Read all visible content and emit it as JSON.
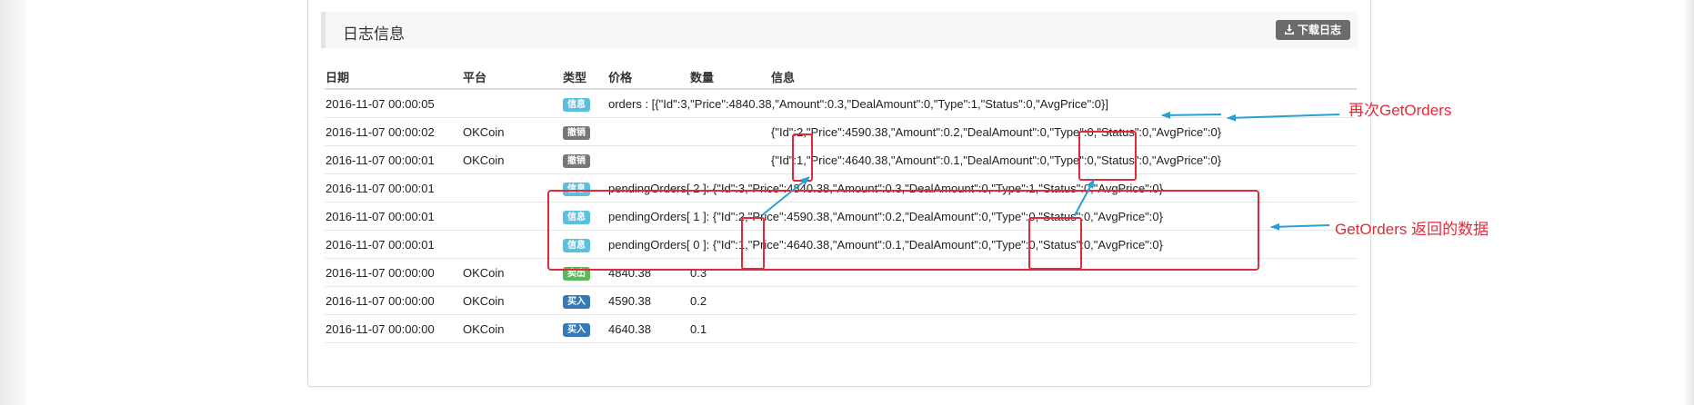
{
  "panel": {
    "title": "日志信息",
    "download_label": "下载日志"
  },
  "table": {
    "headers": [
      "日期",
      "平台",
      "类型",
      "价格",
      "数量",
      "信息"
    ],
    "rows": [
      {
        "date": "2016-11-07 00:00:05",
        "platform": "",
        "type": "信息",
        "price": "orders : [{\"Id\":3,\"Price\":4840.38,\"Amount\":0.3,\"DealAmount\":0,\"Type\":1,\"Status\":0,\"AvgPrice\":0}]",
        "amount": "",
        "info": ""
      },
      {
        "date": "2016-11-07 00:00:02",
        "platform": "OKCoin",
        "type": "撤销",
        "price": "",
        "amount": "",
        "info": "{\"Id\":2,\"Price\":4590.38,\"Amount\":0.2,\"DealAmount\":0,\"Type\":0,\"Status\":0,\"AvgPrice\":0}"
      },
      {
        "date": "2016-11-07 00:00:01",
        "platform": "OKCoin",
        "type": "撤销",
        "price": "",
        "amount": "",
        "info": "{\"Id\":1,\"Price\":4640.38,\"Amount\":0.1,\"DealAmount\":0,\"Type\":0,\"Status\":0,\"AvgPrice\":0}"
      },
      {
        "date": "2016-11-07 00:00:01",
        "platform": "",
        "type": "信息",
        "price": "pendingOrders[ 2 ]: {\"Id\":3,\"Price\":4840.38,\"Amount\":0.3,\"DealAmount\":0,\"Type\":1,\"Status\":0,\"AvgPrice\":0}",
        "amount": "",
        "info": ""
      },
      {
        "date": "2016-11-07 00:00:01",
        "platform": "",
        "type": "信息",
        "price": "pendingOrders[ 1 ]: {\"Id\":2,\"Price\":4590.38,\"Amount\":0.2,\"DealAmount\":0,\"Type\":0,\"Status\":0,\"AvgPrice\":0}",
        "amount": "",
        "info": ""
      },
      {
        "date": "2016-11-07 00:00:01",
        "platform": "",
        "type": "信息",
        "price": "pendingOrders[ 0 ]: {\"Id\":1,\"Price\":4640.38,\"Amount\":0.1,\"DealAmount\":0,\"Type\":0,\"Status\":0,\"AvgPrice\":0}",
        "amount": "",
        "info": ""
      },
      {
        "date": "2016-11-07 00:00:00",
        "platform": "OKCoin",
        "type": "卖出",
        "price": "4840.38",
        "amount": "0.3",
        "info": ""
      },
      {
        "date": "2016-11-07 00:00:00",
        "platform": "OKCoin",
        "type": "买入",
        "price": "4590.38",
        "amount": "0.2",
        "info": ""
      },
      {
        "date": "2016-11-07 00:00:00",
        "platform": "OKCoin",
        "type": "买入",
        "price": "4640.38",
        "amount": "0.1",
        "info": ""
      }
    ]
  },
  "badge_colors": {
    "信息": "#5bc0de",
    "撤销": "#777777",
    "卖出": "#5cb85c",
    "买入": "#337ab7"
  },
  "annotations": {
    "again_getorders": "再次GetOrders",
    "getorders_returned": "GetOrders 返回的数据",
    "color": "#e22b3a",
    "arrow_color": "#2a9fd6"
  }
}
